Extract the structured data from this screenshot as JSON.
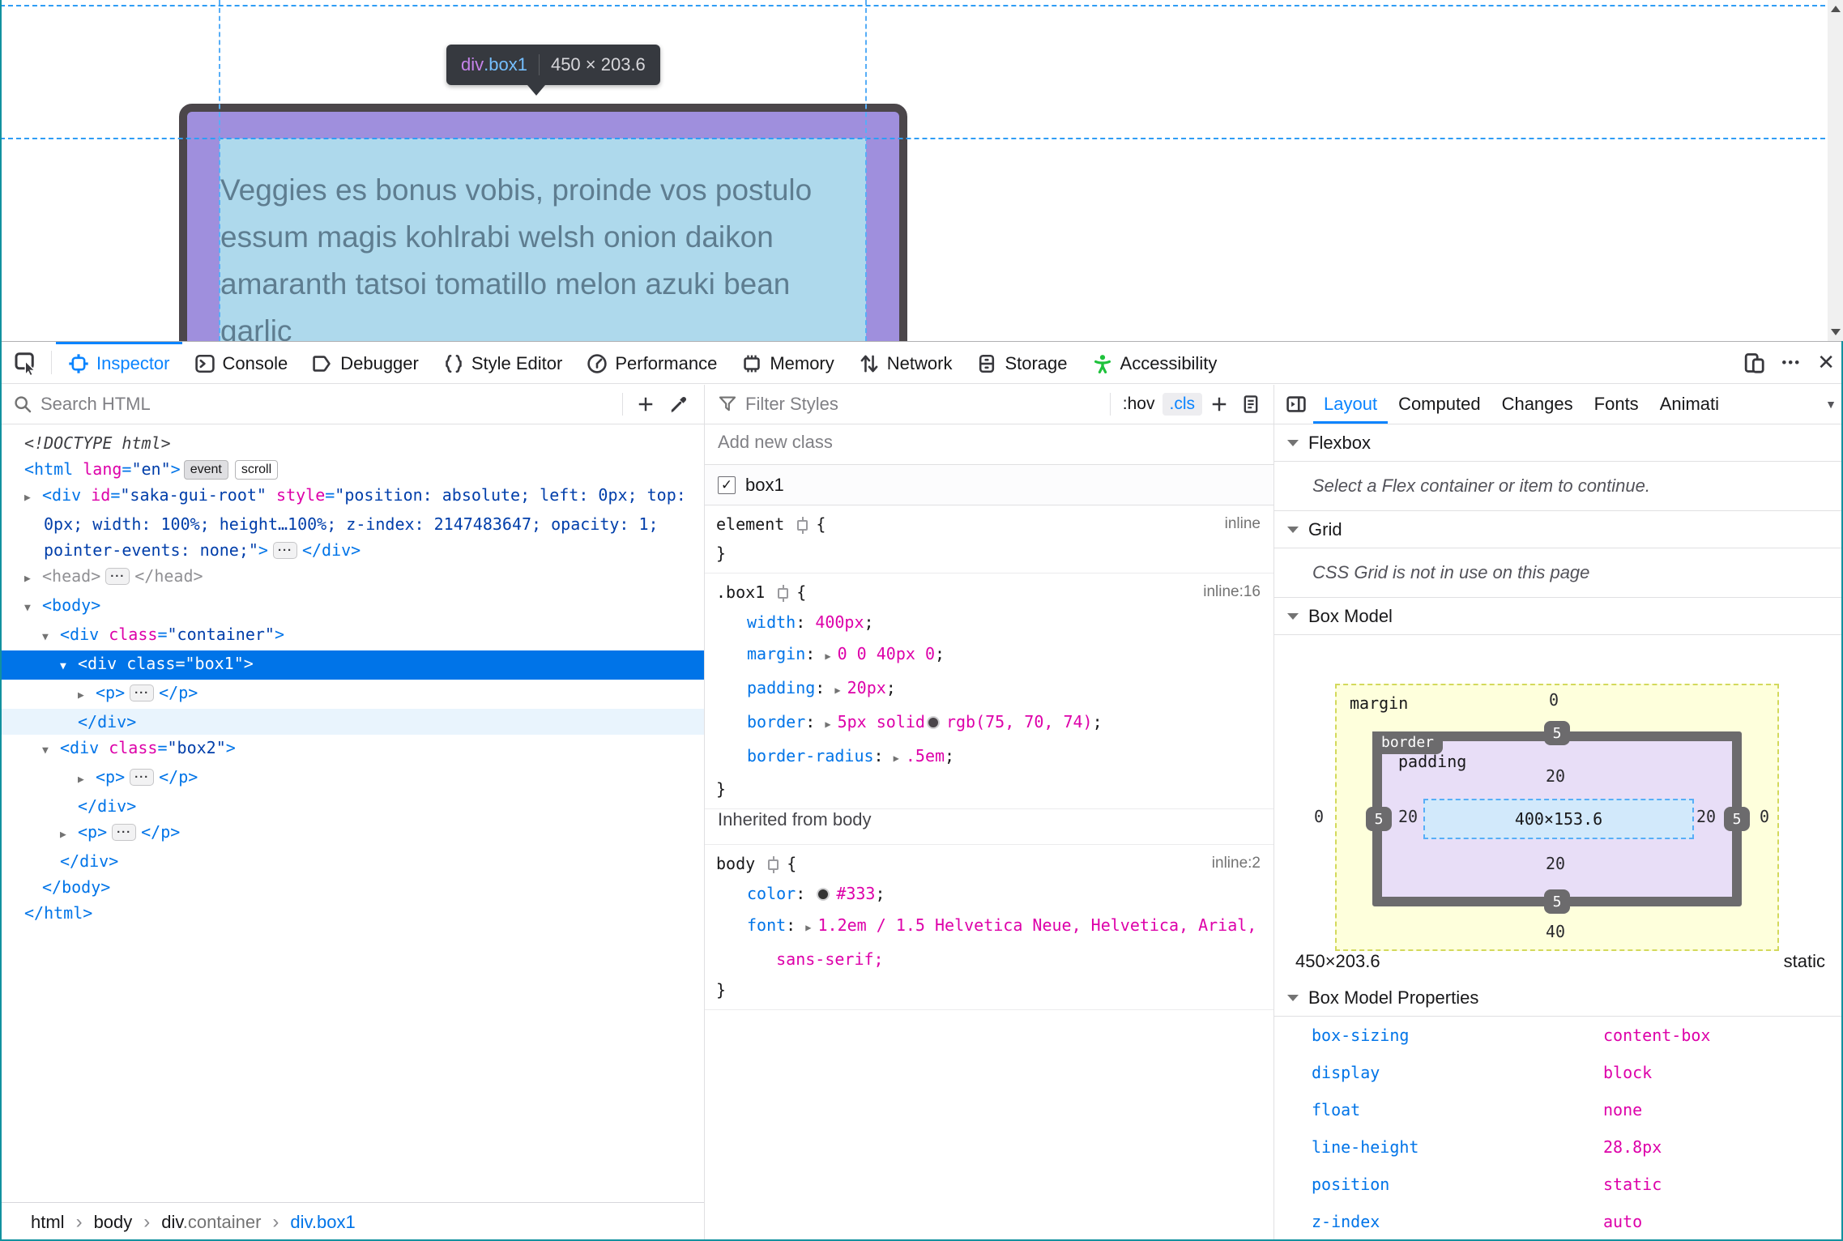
{
  "page": {
    "infobar": {
      "tag": "div",
      "class": ".box1",
      "dims": "450 × 203.6"
    },
    "box_text": {
      "lines": [
        "Veggies es bonus vobis, proinde vos postulo",
        "essum magis kohlrabi welsh onion daikon",
        "amaranth tatsoi tomatillo melon azuki bean",
        "garlic"
      ]
    },
    "colors": {
      "box_border": "#4b464a",
      "padding_overlay": "#9f8fdd",
      "content_overlay": "#aed9ec",
      "guide": "#2f9df5"
    }
  },
  "toolbox": {
    "tabs": [
      {
        "label": "Inspector"
      },
      {
        "label": "Console"
      },
      {
        "label": "Debugger"
      },
      {
        "label": "Style Editor"
      },
      {
        "label": "Performance"
      },
      {
        "label": "Memory"
      },
      {
        "label": "Network"
      },
      {
        "label": "Storage"
      },
      {
        "label": "Accessibility"
      }
    ],
    "meatballs": "•••",
    "close": "✕",
    "accent": "#0a84ff",
    "a11y_green": "#1fc23c"
  },
  "markup": {
    "search_placeholder": "Search HTML",
    "rows": [
      [
        {
          "c": "spacer"
        },
        {
          "t": "<!DOCTYPE html>",
          "c": "doctype"
        }
      ],
      [
        {
          "c": "spacer"
        },
        {
          "t": "<html ",
          "c": "tag"
        },
        {
          "t": "lang",
          "c": "attr"
        },
        {
          "t": "=",
          "c": "tag"
        },
        {
          "t": "\"en\"",
          "c": "val"
        },
        {
          "t": ">",
          "c": "tag"
        },
        {
          "t": "event",
          "c": "badge-filled"
        },
        {
          "t": "scroll",
          "c": "badge"
        }
      ],
      [
        {
          "t": "▶",
          "c": "twisty"
        },
        {
          "t": "<div ",
          "c": "tag"
        },
        {
          "t": "id",
          "c": "attr"
        },
        {
          "t": "=",
          "c": "tag"
        },
        {
          "t": "\"saka-gui-root\"",
          "c": "val"
        },
        {
          "t": " ",
          "c": "plain"
        },
        {
          "t": "style",
          "c": "attr"
        },
        {
          "t": "=",
          "c": "tag"
        },
        {
          "t": "\"position: absolute; left: 0px; top:",
          "c": "val"
        }
      ],
      [
        {
          "t": "0px; width: 100%; height…100%; z-index: 2147483647; opacity: 1;",
          "c": "val"
        }
      ],
      [
        {
          "t": "pointer-events: none;\"",
          "c": "val"
        },
        {
          "t": ">",
          "c": "tag"
        },
        {
          "t": "···",
          "c": "pill"
        },
        {
          "t": "</div>",
          "c": "tag"
        }
      ],
      [
        {
          "t": "▶",
          "c": "twisty"
        },
        {
          "t": "<head>",
          "c": "dim"
        },
        {
          "t": "···",
          "c": "pill"
        },
        {
          "t": "</head>",
          "c": "dim"
        }
      ],
      [
        {
          "t": "▼",
          "c": "twisty"
        },
        {
          "t": "<body>",
          "c": "tag"
        }
      ],
      [
        {
          "t": "▼",
          "c": "twisty"
        },
        {
          "t": "<div ",
          "c": "tag"
        },
        {
          "t": "class",
          "c": "attr"
        },
        {
          "t": "=",
          "c": "tag"
        },
        {
          "t": "\"container\"",
          "c": "val"
        },
        {
          "t": ">",
          "c": "tag"
        }
      ],
      [
        {
          "t": "▼",
          "c": "twisty"
        },
        {
          "t": "<div ",
          "c": "tag"
        },
        {
          "t": "class",
          "c": "tag"
        },
        {
          "t": "=",
          "c": "tag"
        },
        {
          "t": "\"box1\"",
          "c": "tag"
        },
        {
          "t": ">",
          "c": "tag"
        }
      ],
      [
        {
          "t": "▶",
          "c": "twisty"
        },
        {
          "t": "<p>",
          "c": "tag"
        },
        {
          "t": "···",
          "c": "pill"
        },
        {
          "t": "</p>",
          "c": "tag"
        }
      ],
      [
        {
          "c": "spacer"
        },
        {
          "t": "</div>",
          "c": "tag"
        }
      ],
      [
        {
          "t": "▼",
          "c": "twisty"
        },
        {
          "t": "<div ",
          "c": "tag"
        },
        {
          "t": "class",
          "c": "attr"
        },
        {
          "t": "=",
          "c": "tag"
        },
        {
          "t": "\"box2\"",
          "c": "val"
        },
        {
          "t": ">",
          "c": "tag"
        }
      ],
      [
        {
          "t": "▶",
          "c": "twisty"
        },
        {
          "t": "<p>",
          "c": "tag"
        },
        {
          "t": "···",
          "c": "pill"
        },
        {
          "t": "</p>",
          "c": "tag"
        }
      ],
      [
        {
          "c": "spacer"
        },
        {
          "t": "</div>",
          "c": "tag"
        }
      ],
      [
        {
          "t": "▶",
          "c": "twisty"
        },
        {
          "t": "<p>",
          "c": "tag"
        },
        {
          "t": "···",
          "c": "pill"
        },
        {
          "t": "</p>",
          "c": "tag"
        }
      ],
      [
        {
          "c": "spacer"
        },
        {
          "t": "</div>",
          "c": "tag"
        }
      ],
      [
        {
          "c": "spacer"
        },
        {
          "t": "</body>",
          "c": "tag"
        }
      ],
      [
        {
          "c": "spacer"
        },
        {
          "t": "</html>",
          "c": "tag"
        }
      ]
    ],
    "breadcrumb": [
      {
        "label": "html"
      },
      {
        "label": "body"
      },
      {
        "label": "div",
        "suffix": ".container"
      },
      {
        "label": "div.box1"
      }
    ]
  },
  "styles": {
    "filter_placeholder": "Filter Styles",
    "hov_btn": ":hov",
    "cls_btn": ".cls",
    "add_class_placeholder": "Add new class",
    "class_item": "box1",
    "close_brace": "}",
    "inherited_header": "Inherited from body",
    "rules": [
      {
        "sel": [
          {
            "t": "element ",
            "c": "selc"
          },
          {
            "c": "icon-target"
          },
          {
            "t": "{",
            "c": "pn"
          }
        ],
        "link": "inline",
        "decls": []
      },
      {
        "sel": [
          {
            "t": ".box1 ",
            "c": "selc"
          },
          {
            "c": "icon-target"
          },
          {
            "t": "{",
            "c": "pn"
          }
        ],
        "link": "inline:16",
        "decls": [
          [
            {
              "t": "width",
              "c": "prop"
            },
            {
              "t": ": ",
              "c": "pn"
            },
            {
              "t": "400px",
              "c": "value"
            },
            {
              "t": ";",
              "c": "pn"
            }
          ],
          [
            {
              "t": "margin",
              "c": "prop"
            },
            {
              "t": ": ",
              "c": "pn"
            },
            {
              "t": "▶",
              "c": "exp"
            },
            {
              "t": "0 0 40px 0",
              "c": "value"
            },
            {
              "t": ";",
              "c": "pn"
            }
          ],
          [
            {
              "t": "padding",
              "c": "prop"
            },
            {
              "t": ": ",
              "c": "pn"
            },
            {
              "t": "▶",
              "c": "exp"
            },
            {
              "t": "20px",
              "c": "value"
            },
            {
              "t": ";",
              "c": "pn"
            }
          ],
          [
            {
              "t": "border",
              "c": "prop"
            },
            {
              "t": ": ",
              "c": "pn"
            },
            {
              "t": "▶",
              "c": "exp"
            },
            {
              "t": "5px solid",
              "c": "value"
            },
            {
              "c": "swatch",
              "bg": "#4b464a"
            },
            {
              "t": "rgb(75, 70, 74)",
              "c": "value"
            },
            {
              "t": ";",
              "c": "pn"
            }
          ],
          [
            {
              "t": "border-radius",
              "c": "prop"
            },
            {
              "t": ": ",
              "c": "pn"
            },
            {
              "t": "▶",
              "c": "exp"
            },
            {
              "t": ".5em",
              "c": "value"
            },
            {
              "t": ";",
              "c": "pn"
            }
          ]
        ]
      }
    ],
    "body_rule": {
      "sel": [
        {
          "t": "body ",
          "c": "selc"
        },
        {
          "c": "icon-target"
        },
        {
          "t": "{",
          "c": "pn"
        }
      ],
      "link": "inline:2",
      "decls": [
        [
          {
            "t": "color",
            "c": "prop"
          },
          {
            "t": ": ",
            "c": "pn"
          },
          {
            "c": "swatch",
            "bg": "#333333"
          },
          {
            "t": "#333",
            "c": "value"
          },
          {
            "t": ";",
            "c": "pn"
          }
        ],
        [
          {
            "t": "font",
            "c": "prop"
          },
          {
            "t": ": ",
            "c": "pn"
          },
          {
            "t": "▶",
            "c": "exp"
          },
          {
            "t": "1.2em / 1.5 Helvetica Neue, Helvetica, Arial,",
            "c": "value"
          }
        ],
        [
          {
            "t": "   ",
            "c": "pn"
          },
          {
            "t": "sans-serif;",
            "c": "value"
          }
        ]
      ]
    }
  },
  "layout_panel": {
    "tabs": [
      "Layout",
      "Computed",
      "Changes",
      "Fonts",
      "Animati"
    ],
    "flexbox": {
      "title": "Flexbox",
      "empty": "Select a Flex container or item to continue."
    },
    "grid": {
      "title": "Grid",
      "empty": "CSS Grid is not in use on this page"
    },
    "box_model": {
      "title": "Box Model",
      "margin_label": "margin",
      "border_label": "border",
      "padding_label": "padding",
      "content": "400×153.6",
      "margin": {
        "top": "0",
        "right": "0",
        "bottom": "40",
        "left": "0"
      },
      "border": {
        "top": "5",
        "right": "5",
        "bottom": "5",
        "left": "5"
      },
      "padding": {
        "top": "20",
        "right": "20",
        "bottom": "20",
        "left": "20"
      },
      "dims": "450×203.6",
      "position": "static",
      "props_title": "Box Model Properties",
      "properties": [
        {
          "name": "box-sizing",
          "value": "content-box"
        },
        {
          "name": "display",
          "value": "block"
        },
        {
          "name": "float",
          "value": "none"
        },
        {
          "name": "line-height",
          "value": "28.8px"
        },
        {
          "name": "position",
          "value": "static"
        },
        {
          "name": "z-index",
          "value": "auto"
        }
      ]
    }
  }
}
